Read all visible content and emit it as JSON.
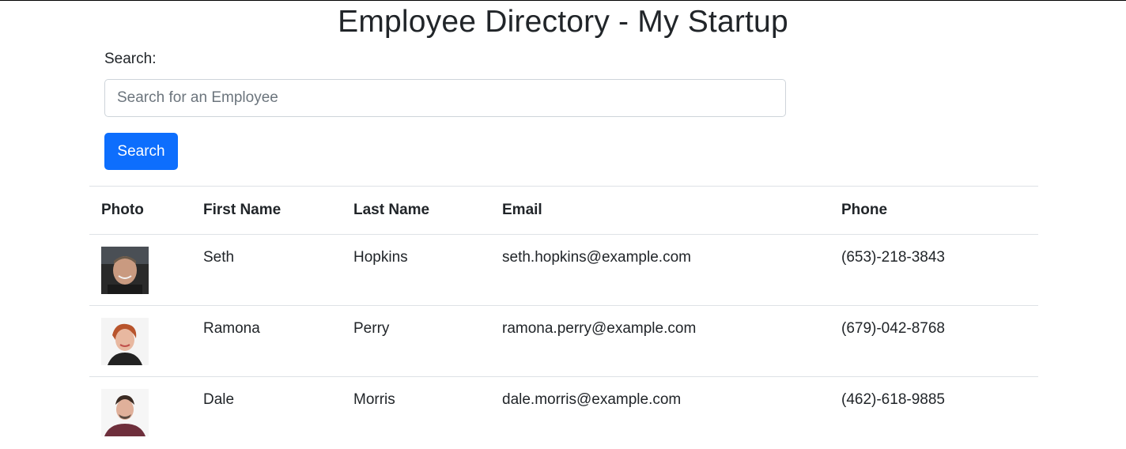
{
  "page": {
    "title": "Employee Directory - My Startup"
  },
  "search": {
    "label": "Search:",
    "placeholder": "Search for an Employee",
    "value": "",
    "button_label": "Search"
  },
  "table": {
    "headers": [
      "Photo",
      "First Name",
      "Last Name",
      "Email",
      "Phone"
    ],
    "rows": [
      {
        "photo": "employee-photo",
        "first": "Seth",
        "last": "Hopkins",
        "email": "seth.hopkins@example.com",
        "phone": "(653)-218-3843"
      },
      {
        "photo": "employee-photo",
        "first": "Ramona",
        "last": "Perry",
        "email": "ramona.perry@example.com",
        "phone": "(679)-042-8768"
      },
      {
        "photo": "employee-photo",
        "first": "Dale",
        "last": "Morris",
        "email": "dale.morris@example.com",
        "phone": "(462)-618-9885"
      }
    ]
  },
  "colors": {
    "primary_button": "#0d6efd",
    "border": "#dee2e6",
    "text": "#212529",
    "placeholder": "#6c757d"
  }
}
